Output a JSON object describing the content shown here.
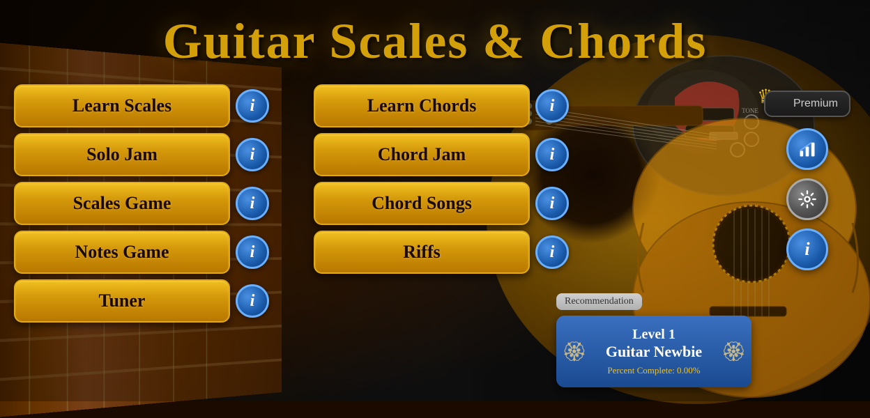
{
  "app": {
    "title": "Guitar Scales & Chords"
  },
  "left_buttons": [
    {
      "id": "learn-scales",
      "label": "Learn Scales"
    },
    {
      "id": "solo-jam",
      "label": "Solo Jam"
    },
    {
      "id": "scales-game",
      "label": "Scales Game"
    },
    {
      "id": "notes-game",
      "label": "Notes Game"
    },
    {
      "id": "tuner",
      "label": "Tuner"
    }
  ],
  "right_buttons": [
    {
      "id": "learn-chords",
      "label": "Learn Chords"
    },
    {
      "id": "chord-jam",
      "label": "Chord Jam"
    },
    {
      "id": "chord-songs",
      "label": "Chord Songs"
    },
    {
      "id": "riffs",
      "label": "Riffs"
    }
  ],
  "premium": {
    "label": "Premium"
  },
  "recommendation": {
    "section_label": "Recommendation",
    "level_number": "Level 1",
    "level_name": "Guitar Newbie",
    "percent_label": "Percent Complete:",
    "percent_value": "0.00%"
  },
  "icons": {
    "info": "i",
    "crown": "♛",
    "laurel_left": "🏵",
    "laurel_right": "🏵"
  }
}
